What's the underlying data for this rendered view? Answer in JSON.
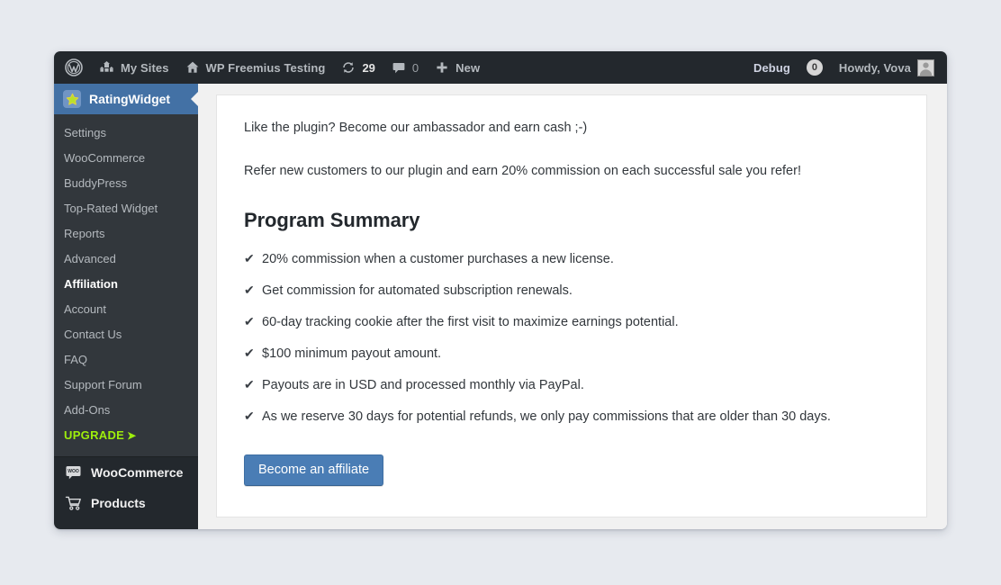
{
  "adminbar": {
    "wp_logo_icon": "wordpress-logo-icon",
    "my_sites": {
      "label": "My Sites",
      "icon": "multisite-buildings-icon"
    },
    "site": {
      "label": "WP Freemius Testing",
      "icon": "home-icon"
    },
    "updates": {
      "count": "29",
      "icon": "update-circular-arrows-icon"
    },
    "comments": {
      "count": "0",
      "icon": "comment-bubble-icon"
    },
    "new": {
      "label": "New",
      "icon": "plus-icon"
    },
    "debug": {
      "label": "Debug"
    },
    "debug_count": "0",
    "howdy": {
      "label": "Howdy, Vova",
      "avatar_icon": "user-avatar-icon"
    }
  },
  "sidebar": {
    "top": {
      "label": "RatingWidget",
      "icon": "ratingwidget-star-icon"
    },
    "submenu": [
      {
        "label": "Settings",
        "state": "default"
      },
      {
        "label": "WooCommerce",
        "state": "default"
      },
      {
        "label": "BuddyPress",
        "state": "default"
      },
      {
        "label": "Top-Rated Widget",
        "state": "default"
      },
      {
        "label": "Reports",
        "state": "default"
      },
      {
        "label": "Advanced",
        "state": "default"
      },
      {
        "label": "Affiliation",
        "state": "current"
      },
      {
        "label": "Account",
        "state": "default"
      },
      {
        "label": "Contact Us",
        "state": "default"
      },
      {
        "label": "FAQ",
        "state": "default"
      },
      {
        "label": "Support Forum",
        "state": "default"
      },
      {
        "label": "Add-Ons",
        "state": "default"
      },
      {
        "label": "UPGRADE",
        "state": "upgrade",
        "arrow": "➤"
      }
    ],
    "bottom": [
      {
        "label": "WooCommerce",
        "icon": "woocommerce-icon"
      },
      {
        "label": "Products",
        "icon": "shopping-cart-icon"
      }
    ],
    "colors": {
      "bar": "#23282d",
      "submenu": "#32373c",
      "current": "#4371a5",
      "upgrade": "#9eee0c"
    }
  },
  "main": {
    "intro_1": "Like the plugin? Become our ambassador and earn cash ;-)",
    "intro_2": "Refer new customers to our plugin and earn 20% commission on each successful sale you refer!",
    "heading": "Program Summary",
    "check_icon": "✔",
    "benefits": [
      "20% commission when a customer purchases a new license.",
      "Get commission for automated subscription renewals.",
      "60-day tracking cookie after the first visit to maximize earnings potential.",
      "$100 minimum payout amount.",
      "Payouts are in USD and processed monthly via PayPal.",
      "As we reserve 30 days for potential refunds, we only pay commissions that are older than 30 days."
    ],
    "cta_label": "Become an affiliate",
    "cta_color": "#4a7db5"
  }
}
